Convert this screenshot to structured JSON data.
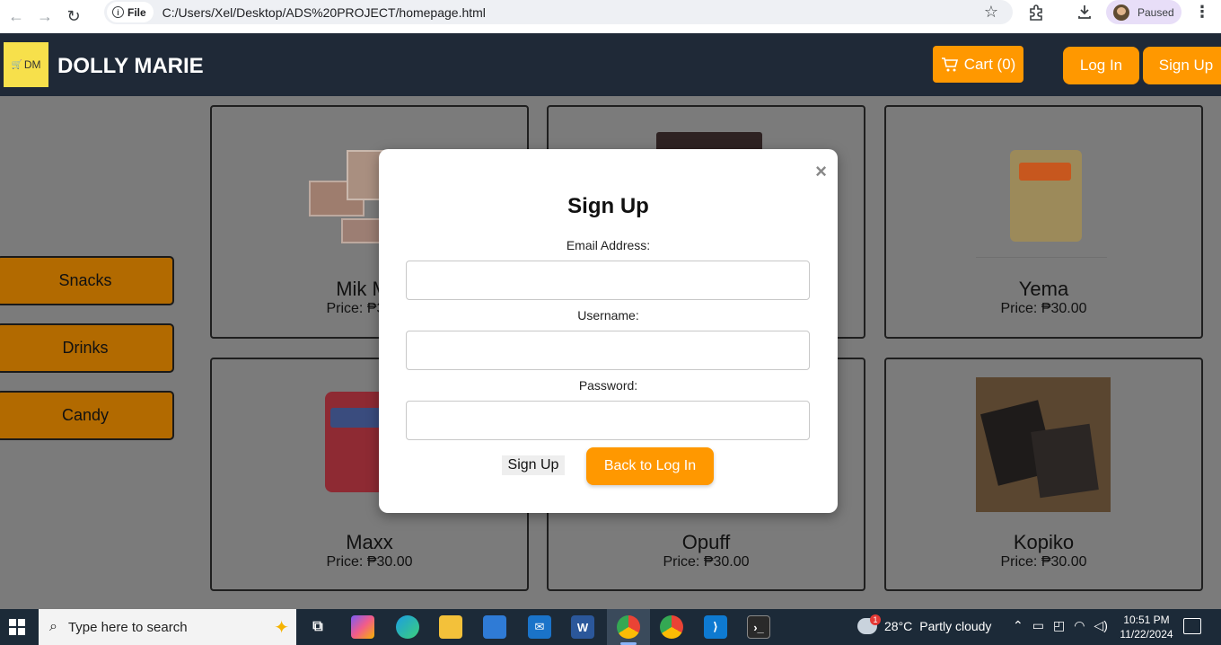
{
  "browser": {
    "file_chip": "File",
    "url": "C:/Users/Xel/Desktop/ADS%20PROJECT/homepage.html",
    "profile_status": "Paused"
  },
  "site": {
    "logo_text": "DM",
    "brand": "DOLLY MARIE",
    "cart_label": "Cart (0)",
    "login_label": "Log In",
    "signup_label": "Sign Up"
  },
  "categories": [
    "Snacks",
    "Drinks",
    "Candy"
  ],
  "products": [
    {
      "name": "Mik Mik",
      "price": "Price: ₱30.00"
    },
    {
      "name": "",
      "price": ""
    },
    {
      "name": "Yema",
      "price": "Price: ₱30.00"
    },
    {
      "name": "Maxx",
      "price": "Price: ₱30.00"
    },
    {
      "name": "Opuff",
      "price": "Price: ₱30.00"
    },
    {
      "name": "Kopiko",
      "price": "Price: ₱30.00"
    }
  ],
  "modal": {
    "close_glyph": "×",
    "title": "Sign Up",
    "email_label": "Email Address:",
    "username_label": "Username:",
    "password_label": "Password:",
    "email_value": "",
    "username_value": "",
    "password_value": "",
    "submit_label": "Sign Up",
    "back_label": "Back to Log In"
  },
  "taskbar": {
    "search_placeholder": "Type here to search",
    "weather_temp": "28°C",
    "weather_desc": "Partly cloudy",
    "weather_badge": "1",
    "time": "10:51 PM",
    "date": "11/22/2024"
  },
  "colors": {
    "header_bg": "#1f2937",
    "accent": "#ff9800",
    "category_btn": "#b26a00",
    "logo_bg": "#f7e04b"
  }
}
